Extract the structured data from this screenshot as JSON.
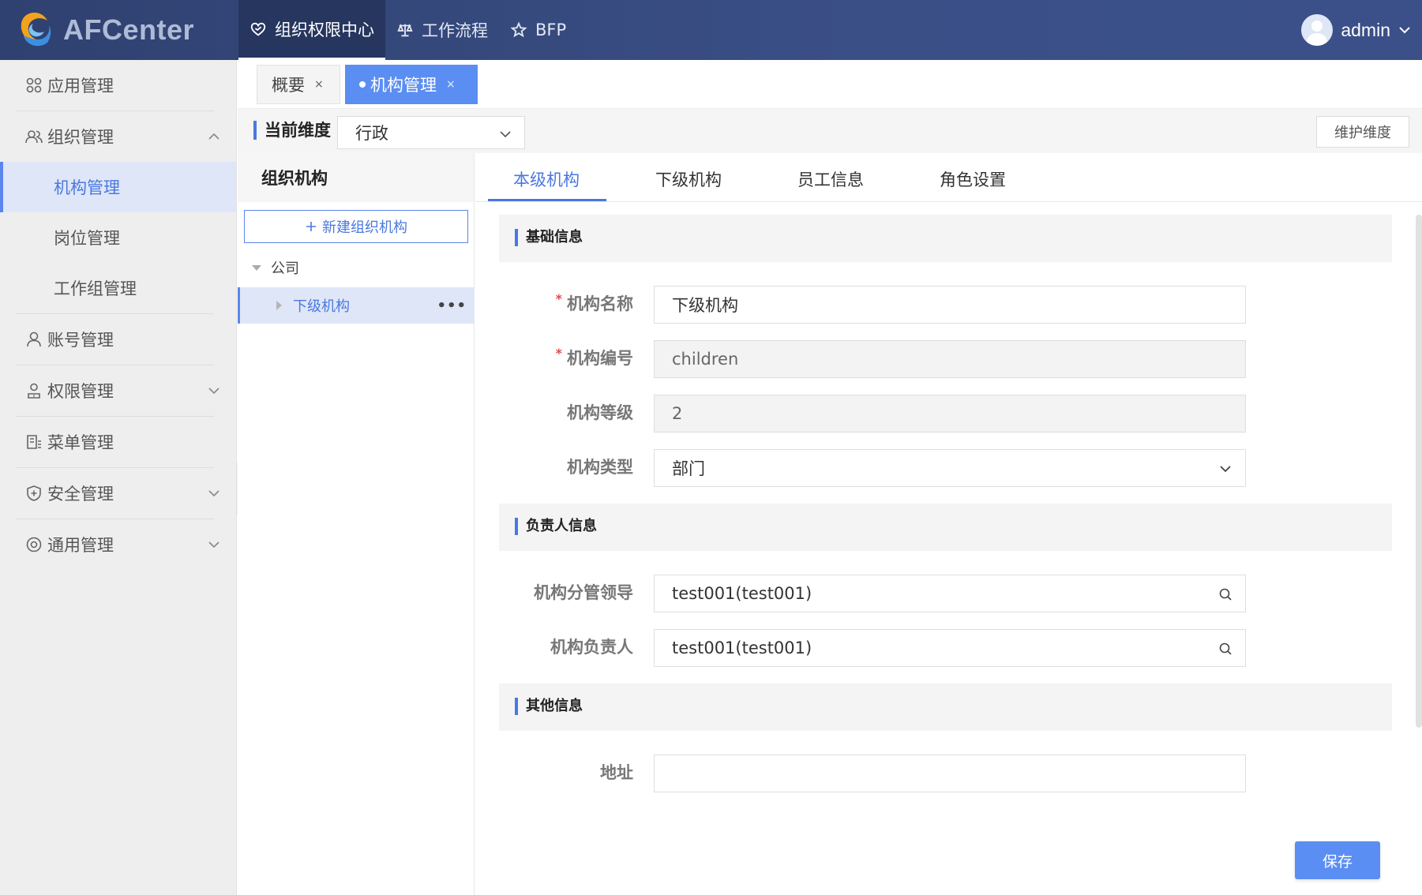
{
  "app": {
    "brand": "AFCenter"
  },
  "nav": [
    {
      "label": "组织权限中心",
      "icon": "heart-shield-icon",
      "active": true
    },
    {
      "label": "工作流程",
      "icon": "balance-scale-icon",
      "active": false
    },
    {
      "label": "BFP",
      "icon": "star-icon",
      "active": false
    }
  ],
  "user": {
    "name": "admin"
  },
  "sidebar": {
    "app_mgmt": "应用管理",
    "org_mgmt": "组织管理",
    "org_sub": [
      "机构管理",
      "岗位管理",
      "工作组管理"
    ],
    "account_mgmt": "账号管理",
    "perm_mgmt": "权限管理",
    "menu_mgmt": "菜单管理",
    "security_mgmt": "安全管理",
    "general_mgmt": "通用管理"
  },
  "tabs": {
    "overview": "概要",
    "org": "机构管理",
    "close": "×"
  },
  "dimension": {
    "label": "当前维度",
    "value": "行政",
    "maintain_button": "维护维度"
  },
  "tree": {
    "title": "组织机构",
    "new_button": "新建组织机构",
    "root": "公司",
    "child": "下级机构",
    "more": "•••"
  },
  "detail": {
    "tabs": [
      "本级机构",
      "下级机构",
      "员工信息",
      "角色设置"
    ],
    "sections": {
      "basic": "基础信息",
      "owner": "负责人信息",
      "other": "其他信息"
    },
    "fields": {
      "name_label": "机构名称",
      "name_value": "下级机构",
      "code_label": "机构编号",
      "code_value": "children",
      "level_label": "机构等级",
      "level_value": "2",
      "type_label": "机构类型",
      "type_value": "部门",
      "leader_label": "机构分管领导",
      "leader_value": "test001(test001)",
      "owner_label": "机构负责人",
      "owner_value": "test001(test001)",
      "address_label": "地址",
      "address_value": ""
    },
    "required_mark": "*",
    "save_button": "保存"
  }
}
